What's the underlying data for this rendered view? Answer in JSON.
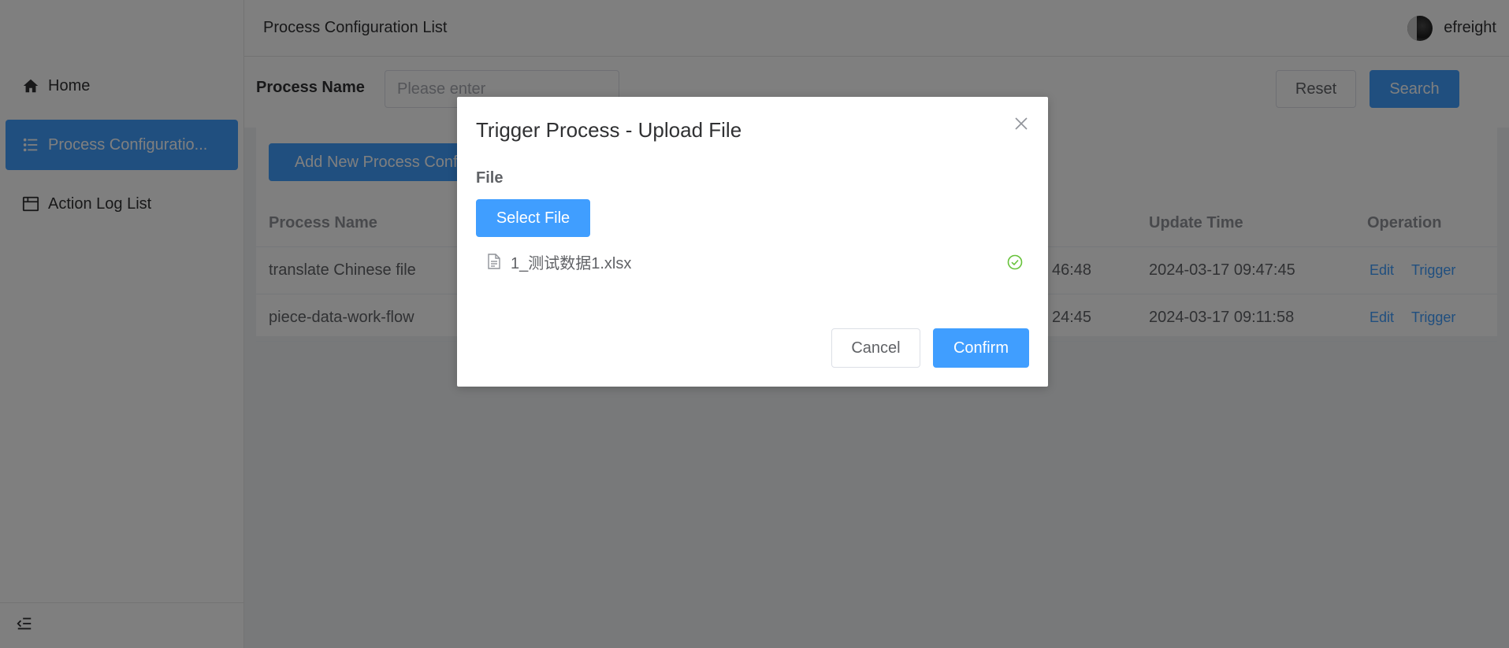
{
  "sidebar": {
    "items": [
      {
        "label": "Home",
        "icon": "home-icon"
      },
      {
        "label": "Process Configuratio...",
        "icon": "list-icon",
        "active": true
      },
      {
        "label": "Action Log List",
        "icon": "window-icon"
      }
    ],
    "collapse_icon": "collapse-icon"
  },
  "header": {
    "title": "Process Configuration List",
    "user_name": "efreight"
  },
  "search": {
    "label": "Process Name",
    "placeholder": "Please enter",
    "reset_label": "Reset",
    "search_label": "Search"
  },
  "toolbar": {
    "add_label": "Add New Process Config"
  },
  "table": {
    "columns": {
      "name": "Process Name",
      "update": "Update Time",
      "operation": "Operation"
    },
    "rows": [
      {
        "name": "translate Chinese file",
        "create_time_partial": "46:48",
        "update_time": "2024-03-17 09:47:45",
        "edit": "Edit",
        "trigger": "Trigger"
      },
      {
        "name": "piece-data-work-flow",
        "create_time_partial": "24:45",
        "update_time": "2024-03-17 09:11:58",
        "edit": "Edit",
        "trigger": "Trigger"
      }
    ]
  },
  "dialog": {
    "title": "Trigger Process - Upload File",
    "file_label": "File",
    "select_file_label": "Select File",
    "file_name": "1_测试数据1.xlsx",
    "cancel_label": "Cancel",
    "confirm_label": "Confirm"
  },
  "colors": {
    "primary": "#409eff",
    "success": "#67c23a",
    "overlay": "rgba(0,0,0,0.5)"
  }
}
